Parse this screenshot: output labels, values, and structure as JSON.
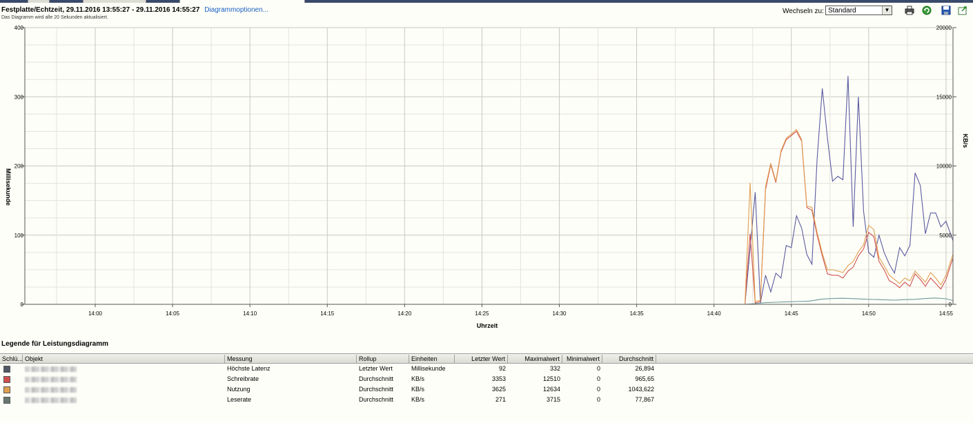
{
  "header": {
    "title": "Festplatte/Echtzeit, 29.11.2016 13:55:27 - 29.11.2016 14:55:27",
    "options_link": "Diagrammoptionen...",
    "subtitle": "Das Diagramm wird alle 20 Sekunden aktualisiert.",
    "switch_label": "Wechseln zu:",
    "switch_value": "Standard"
  },
  "toolbar": {
    "icons": [
      "print-icon",
      "refresh-icon",
      "save-icon",
      "export-icon"
    ]
  },
  "chart_data": {
    "type": "line",
    "xlabel": "Uhrzeit",
    "ylabel_left": "Millisekunde",
    "ylabel_right": "KB/s",
    "ylim_left": [
      0,
      400
    ],
    "ylim_right": [
      0,
      20000
    ],
    "yticks_left": [
      "0",
      "100",
      "200",
      "300",
      "400"
    ],
    "yticks_right": [
      "0",
      "5000",
      "10000",
      "15000",
      "20000"
    ],
    "xticks": [
      "14:00",
      "14:05",
      "14:10",
      "14:15",
      "14:20",
      "14:25",
      "14:30",
      "14:35",
      "14:40",
      "14:45",
      "14:50",
      "14:55"
    ],
    "xlim": [
      "13:55:27",
      "14:55:27"
    ],
    "grid": true,
    "series": [
      {
        "name": "Höchste Latenz",
        "axis": "left",
        "color": "#5a5aa0",
        "x": [
          "13:55:27",
          "14:42:00",
          "14:42:20",
          "14:42:40",
          "14:43:00",
          "14:43:20",
          "14:43:40",
          "14:44:00",
          "14:44:20",
          "14:44:40",
          "14:45:00",
          "14:45:20",
          "14:45:40",
          "14:46:00",
          "14:46:20",
          "14:46:40",
          "14:47:00",
          "14:47:20",
          "14:47:40",
          "14:48:00",
          "14:48:20",
          "14:48:40",
          "14:49:00",
          "14:49:20",
          "14:49:40",
          "14:50:00",
          "14:50:20",
          "14:50:40",
          "14:51:00",
          "14:51:20",
          "14:51:40",
          "14:52:00",
          "14:52:20",
          "14:52:40",
          "14:53:00",
          "14:53:20",
          "14:53:40",
          "14:54:00",
          "14:54:20",
          "14:54:40",
          "14:55:00",
          "14:55:27"
        ],
        "y": [
          0,
          0,
          80,
          162,
          2,
          42,
          18,
          45,
          38,
          85,
          82,
          128,
          110,
          72,
          58,
          210,
          312,
          240,
          178,
          185,
          180,
          330,
          112,
          300,
          135,
          75,
          68,
          100,
          75,
          58,
          45,
          82,
          70,
          85,
          190,
          172,
          102,
          132,
          132,
          112,
          120,
          92
        ]
      },
      {
        "name": "Schreibrate",
        "axis": "right",
        "color": "#d05050",
        "x": [
          "13:55:27",
          "14:42:00",
          "14:42:20",
          "14:42:40",
          "14:43:00",
          "14:43:20",
          "14:43:40",
          "14:44:00",
          "14:44:20",
          "14:44:40",
          "14:45:00",
          "14:45:20",
          "14:45:40",
          "14:46:00",
          "14:46:20",
          "14:46:40",
          "14:47:00",
          "14:47:20",
          "14:47:40",
          "14:48:00",
          "14:48:20",
          "14:48:40",
          "14:49:00",
          "14:49:20",
          "14:49:40",
          "14:50:00",
          "14:50:20",
          "14:50:40",
          "14:51:00",
          "14:51:20",
          "14:51:40",
          "14:52:00",
          "14:52:20",
          "14:52:40",
          "14:53:00",
          "14:53:20",
          "14:53:40",
          "14:54:00",
          "14:54:20",
          "14:54:40",
          "14:55:00",
          "14:55:27"
        ],
        "y": [
          0,
          0,
          5100,
          100,
          200,
          8300,
          10100,
          8800,
          11000,
          11900,
          12200,
          12510,
          11800,
          7000,
          6800,
          5000,
          3500,
          2200,
          2100,
          2100,
          1900,
          2400,
          2700,
          3500,
          4000,
          5200,
          4900,
          3100,
          2500,
          1700,
          1500,
          1200,
          1600,
          1300,
          2200,
          1800,
          1300,
          1900,
          1500,
          1100,
          1800,
          3353
        ]
      },
      {
        "name": "Nutzung",
        "axis": "right",
        "color": "#e0a050",
        "x": [
          "13:55:27",
          "14:42:00",
          "14:42:20",
          "14:42:40",
          "14:43:00",
          "14:43:20",
          "14:43:40",
          "14:44:00",
          "14:44:20",
          "14:44:40",
          "14:45:00",
          "14:45:20",
          "14:45:40",
          "14:46:00",
          "14:46:20",
          "14:46:40",
          "14:47:00",
          "14:47:20",
          "14:47:40",
          "14:48:00",
          "14:48:20",
          "14:48:40",
          "14:49:00",
          "14:49:20",
          "14:49:40",
          "14:50:00",
          "14:50:20",
          "14:50:40",
          "14:51:00",
          "14:51:20",
          "14:51:40",
          "14:52:00",
          "14:52:20",
          "14:52:40",
          "14:53:00",
          "14:53:20",
          "14:53:40",
          "14:54:00",
          "14:54:20",
          "14:54:40",
          "14:55:00",
          "14:55:27"
        ],
        "y": [
          0,
          0,
          8800,
          200,
          300,
          8500,
          10200,
          8900,
          11100,
          12000,
          12300,
          12634,
          11900,
          7100,
          7000,
          5200,
          3700,
          2500,
          2500,
          2400,
          2300,
          2800,
          3100,
          3800,
          4300,
          5700,
          5400,
          3400,
          2800,
          2100,
          1800,
          1500,
          1900,
          1700,
          2400,
          2000,
          1600,
          2300,
          1900,
          1400,
          2100,
          3625
        ]
      },
      {
        "name": "Leserate",
        "axis": "right",
        "color": "#6a9a9a",
        "x": [
          "13:55:27",
          "14:42:00",
          "14:42:40",
          "14:43:20",
          "14:44:00",
          "14:44:40",
          "14:45:20",
          "14:46:00",
          "14:46:20",
          "14:46:40",
          "14:47:00",
          "14:47:40",
          "14:48:20",
          "14:49:00",
          "14:49:40",
          "14:50:20",
          "14:51:00",
          "14:51:40",
          "14:52:20",
          "14:53:00",
          "14:53:40",
          "14:54:20",
          "14:55:00",
          "14:55:27"
        ],
        "y": [
          0,
          0,
          50,
          120,
          150,
          180,
          200,
          220,
          260,
          320,
          380,
          420,
          440,
          410,
          380,
          350,
          330,
          300,
          340,
          360,
          420,
          460,
          400,
          271
        ]
      }
    ]
  },
  "legend": {
    "title": "Legende für Leistungsdiagramm",
    "columns": [
      "Schlü...",
      "Objekt",
      "Messung",
      "Rollup",
      "Einheiten",
      "Letzter Wert",
      "Maximalwert",
      "Minimalwert",
      "Durchschnitt"
    ],
    "rows": [
      {
        "swatch": "#505868",
        "measure": "Höchste Latenz",
        "rollup": "Letzter Wert",
        "unit": "Millisekunde",
        "last": "92",
        "max": "332",
        "min": "0",
        "avg": "26,894"
      },
      {
        "swatch": "#d05050",
        "measure": "Schreibrate",
        "rollup": "Durchschnitt",
        "unit": "KB/s",
        "last": "3353",
        "max": "12510",
        "min": "0",
        "avg": "965,65"
      },
      {
        "swatch": "#e0a050",
        "measure": "Nutzung",
        "rollup": "Durchschnitt",
        "unit": "KB/s",
        "last": "3625",
        "max": "12634",
        "min": "0",
        "avg": "1043,622"
      },
      {
        "swatch": "#687870",
        "measure": "Leserate",
        "rollup": "Durchschnitt",
        "unit": "KB/s",
        "last": "271",
        "max": "3715",
        "min": "0",
        "avg": "77,867"
      }
    ]
  }
}
